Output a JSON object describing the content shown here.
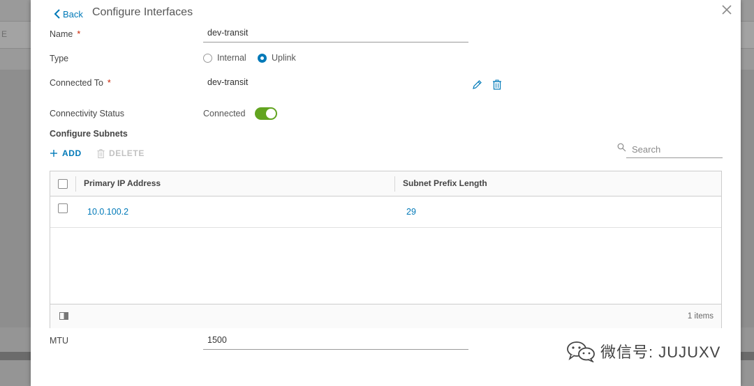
{
  "background": {
    "fragment_left": "E"
  },
  "dialog": {
    "back_label": "Back",
    "title": "Configure Interfaces"
  },
  "form": {
    "name": {
      "label": "Name",
      "required_mark": "*",
      "value": "dev-transit"
    },
    "type": {
      "label": "Type",
      "options": [
        {
          "label": "Internal",
          "selected": false
        },
        {
          "label": "Uplink",
          "selected": true
        }
      ]
    },
    "connected_to": {
      "label": "Connected To",
      "required_mark": "*",
      "value": "dev-transit"
    },
    "connectivity": {
      "label": "Connectivity Status",
      "value": "Connected",
      "on": true
    },
    "subnets": {
      "label": "Configure Subnets"
    },
    "mtu": {
      "label": "MTU",
      "value": "1500"
    }
  },
  "actions": {
    "add_label": "ADD",
    "delete_label": "DELETE"
  },
  "search": {
    "placeholder": "Search"
  },
  "table": {
    "columns": [
      "Primary IP Address",
      "Subnet Prefix Length"
    ],
    "rows": [
      {
        "ip": "10.0.100.2",
        "prefix": "29"
      }
    ],
    "footer_count": "1 items"
  },
  "watermark": {
    "text": "微信号: JUJUXV"
  },
  "colors": {
    "accent": "#0079b8",
    "toggle_on": "#62a420",
    "required": "#c92100"
  }
}
